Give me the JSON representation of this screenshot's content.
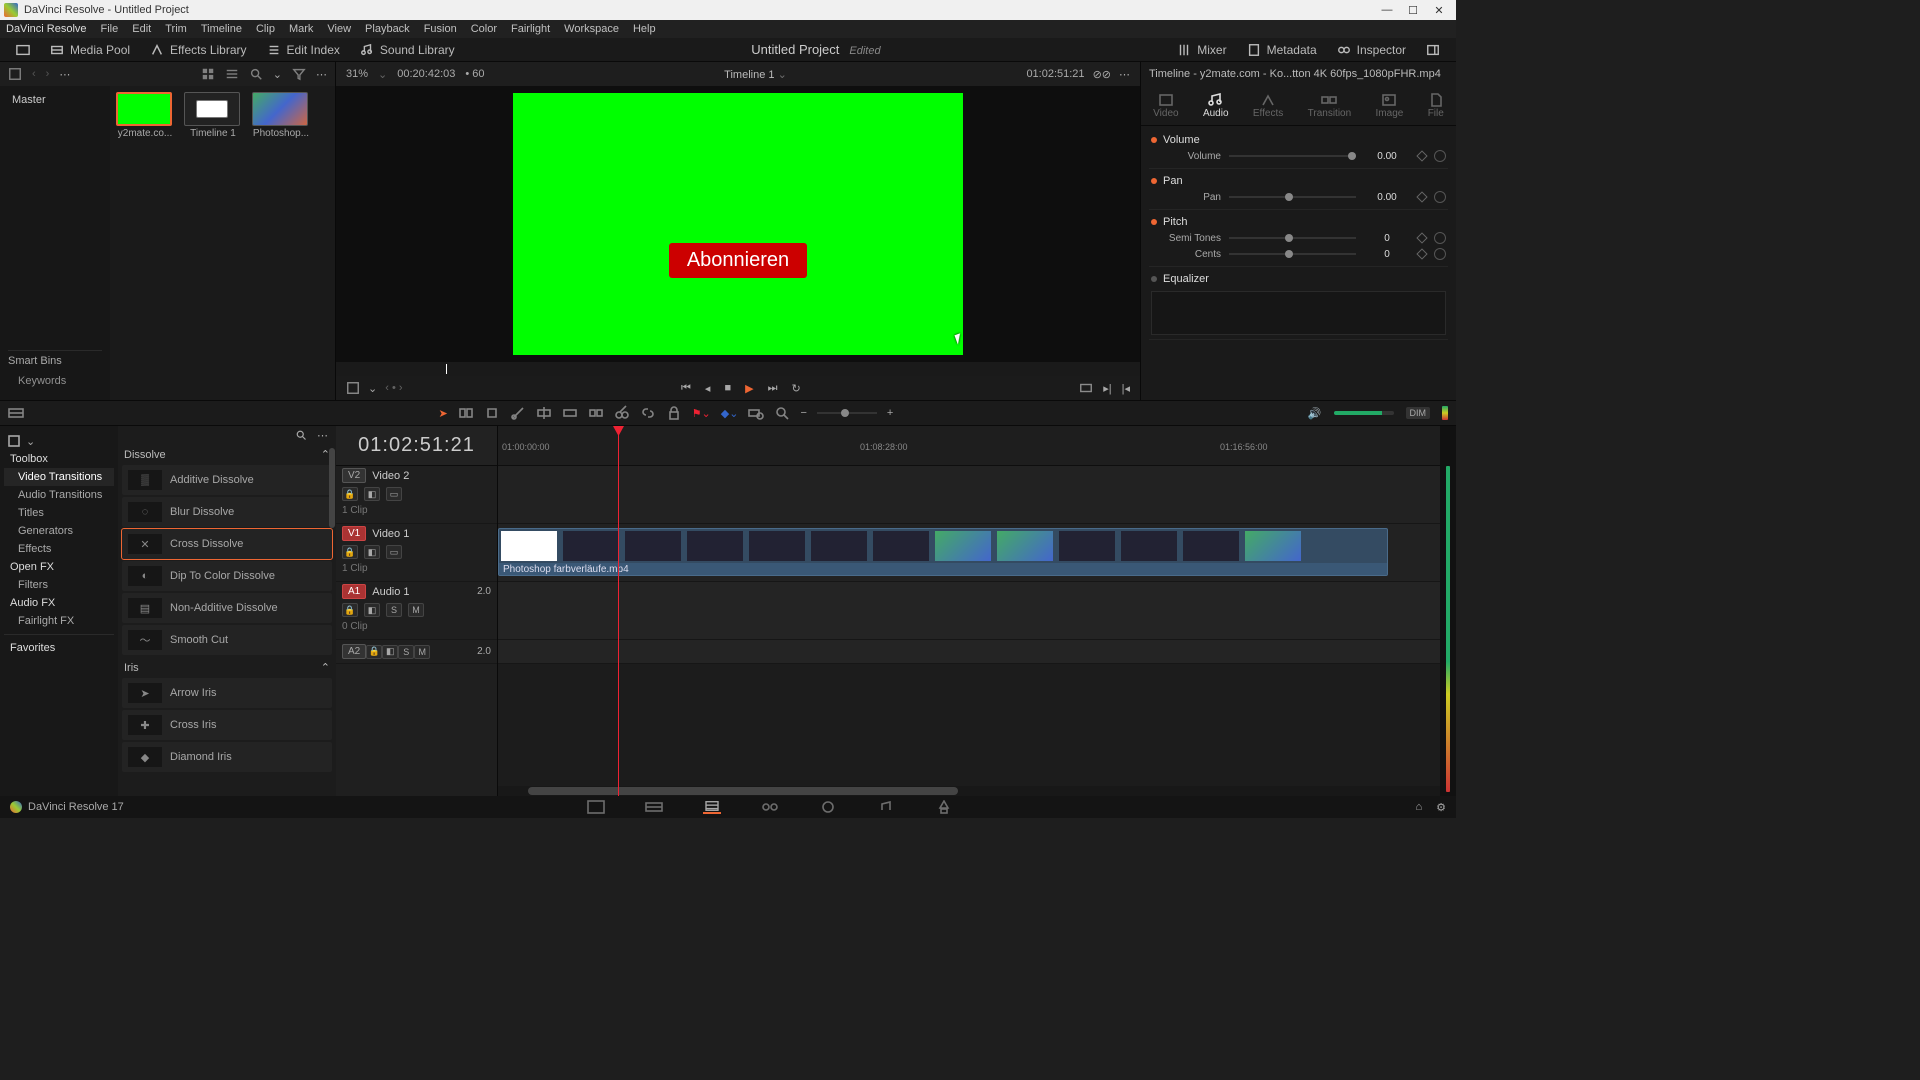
{
  "titlebar": {
    "app_title": "DaVinci Resolve - Untitled Project"
  },
  "menubar": [
    "DaVinci Resolve",
    "File",
    "Edit",
    "Trim",
    "Timeline",
    "Clip",
    "Mark",
    "View",
    "Playback",
    "Fusion",
    "Color",
    "Fairlight",
    "Workspace",
    "Help"
  ],
  "wsbar": {
    "media_pool": "Media Pool",
    "effects_lib": "Effects Library",
    "edit_index": "Edit Index",
    "sound_lib": "Sound Library",
    "project": "Untitled Project",
    "edited": "Edited",
    "mixer": "Mixer",
    "metadata": "Metadata",
    "inspector": "Inspector"
  },
  "mediapool": {
    "master": "Master",
    "smart_bins": "Smart Bins",
    "keywords": "Keywords",
    "clips": [
      {
        "label": "y2mate.co...",
        "kind": "green",
        "selected": true
      },
      {
        "label": "Timeline 1",
        "kind": "tl"
      },
      {
        "label": "Photoshop...",
        "kind": "ps"
      }
    ]
  },
  "viewer": {
    "zoom": "31%",
    "src_tc": "00:20:42:03",
    "src_fps": "• 60",
    "title": "Timeline 1",
    "rec_tc": "01:02:51:21",
    "subscribe_label": "Abonnieren"
  },
  "inspector": {
    "header": "Timeline - y2mate.com - Ko...tton 4K 60fps_1080pFHR.mp4",
    "tabs": [
      "Video",
      "Audio",
      "Effects",
      "Transition",
      "Image",
      "File"
    ],
    "active_tab": 1,
    "volume": {
      "title": "Volume",
      "label": "Volume",
      "value": "0.00"
    },
    "pan": {
      "title": "Pan",
      "label": "Pan",
      "value": "0.00"
    },
    "pitch": {
      "title": "Pitch",
      "semi_label": "Semi Tones",
      "semi_value": "0",
      "cents_label": "Cents",
      "cents_value": "0"
    },
    "eq": {
      "title": "Equalizer"
    }
  },
  "fx": {
    "tree": {
      "toolbox": "Toolbox",
      "video_trans": "Video Transitions",
      "audio_trans": "Audio Transitions",
      "titles": "Titles",
      "generators": "Generators",
      "effects": "Effects",
      "openfx": "Open FX",
      "filters": "Filters",
      "audiofx": "Audio FX",
      "fairlightfx": "Fairlight FX",
      "favorites": "Favorites"
    },
    "sections": [
      {
        "name": "Dissolve",
        "items": [
          "Additive Dissolve",
          "Blur Dissolve",
          "Cross Dissolve",
          "Dip To Color Dissolve",
          "Non-Additive Dissolve",
          "Smooth Cut"
        ],
        "highlight_index": 2
      },
      {
        "name": "Iris",
        "items": [
          "Arrow Iris",
          "Cross Iris",
          "Diamond Iris"
        ]
      }
    ]
  },
  "timeline": {
    "tc": "01:02:51:21",
    "ruler": [
      "01:00:00:00",
      "01:08:28:00",
      "01:16:56:00"
    ],
    "tracks": {
      "v2": {
        "badge": "V2",
        "name": "Video 2",
        "clips": "1 Clip"
      },
      "v1": {
        "badge": "V1",
        "name": "Video 1",
        "clips": "1 Clip"
      },
      "a1": {
        "badge": "A1",
        "name": "Audio 1",
        "clips": "0 Clip",
        "ch": "2.0"
      },
      "a2": {
        "badge": "A2",
        "ch": "2.0"
      }
    },
    "clip_label": "Photoshop farbverläufe.mp4"
  },
  "footer": {
    "app_version": "DaVinci Resolve 17"
  }
}
